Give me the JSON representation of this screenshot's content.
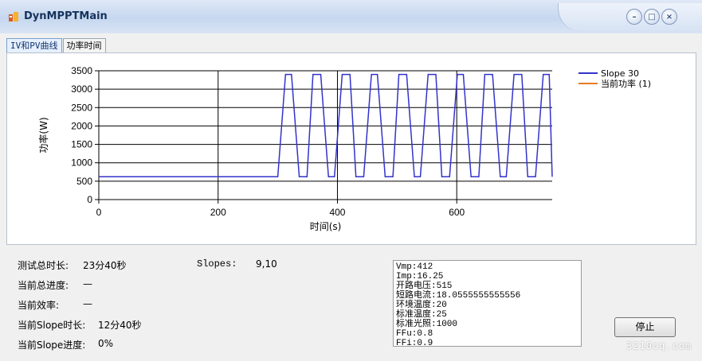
{
  "window": {
    "title": "DynMPPTMain"
  },
  "tabs": [
    {
      "label": "IV和PV曲线"
    },
    {
      "label": "功率时间"
    }
  ],
  "chart_data": {
    "type": "line",
    "ylabel": "功率(W)",
    "xlabel": "时间(s)",
    "xlim": [
      0,
      760
    ],
    "ylim": [
      0,
      3500
    ],
    "xticks": [
      0,
      200,
      400,
      600
    ],
    "yticks": [
      0,
      500,
      1000,
      1500,
      2000,
      2500,
      3000,
      3500
    ],
    "grid": true,
    "legend_position": "top-right",
    "series": [
      {
        "name": "Slope 30",
        "color": "#3333cc",
        "x": [
          0,
          300,
          313,
          323,
          336,
          349,
          359,
          372,
          385,
          395,
          408,
          421,
          431,
          444,
          457,
          467,
          480,
          493,
          503,
          516,
          529,
          539,
          552,
          565,
          575,
          588,
          601,
          611,
          624,
          637,
          647,
          660,
          673,
          683,
          696,
          709,
          719,
          732,
          745,
          755,
          760
        ],
        "values": [
          620,
          620,
          3400,
          3400,
          620,
          620,
          3400,
          3400,
          620,
          620,
          3400,
          3400,
          620,
          620,
          3400,
          3400,
          620,
          620,
          3400,
          3400,
          620,
          620,
          3400,
          3400,
          620,
          620,
          3400,
          3400,
          620,
          620,
          3400,
          3400,
          620,
          620,
          3400,
          3400,
          620,
          620,
          3400,
          3400,
          620
        ]
      },
      {
        "name": "当前功率 (1)",
        "color": "#e87a20",
        "x": [],
        "values": []
      }
    ]
  },
  "info": {
    "total_duration_label": "测试总时长:",
    "total_duration_value": "23分40秒",
    "slopes_label": "Slopes:",
    "slopes_value": "9,10",
    "total_progress_label": "当前总进度:",
    "total_progress_value": "—",
    "efficiency_label": "当前效率:",
    "efficiency_value": "—",
    "slope_duration_label": "当前Slope时长:",
    "slope_duration_value": "12分40秒",
    "slope_progress_label": "当前Slope进度:",
    "slope_progress_value": "0%"
  },
  "infobox_lines": [
    "Vmp:412",
    "Imp:16.25",
    "开路电压:515",
    "短路电流:18.0555555555556",
    "环境温度:20",
    "标准温度:25",
    "标准光照:1000",
    "FFu:0.8",
    "FFi:0.9"
  ],
  "buttons": {
    "stop": "停止"
  },
  "watermark": "3210cq.com"
}
